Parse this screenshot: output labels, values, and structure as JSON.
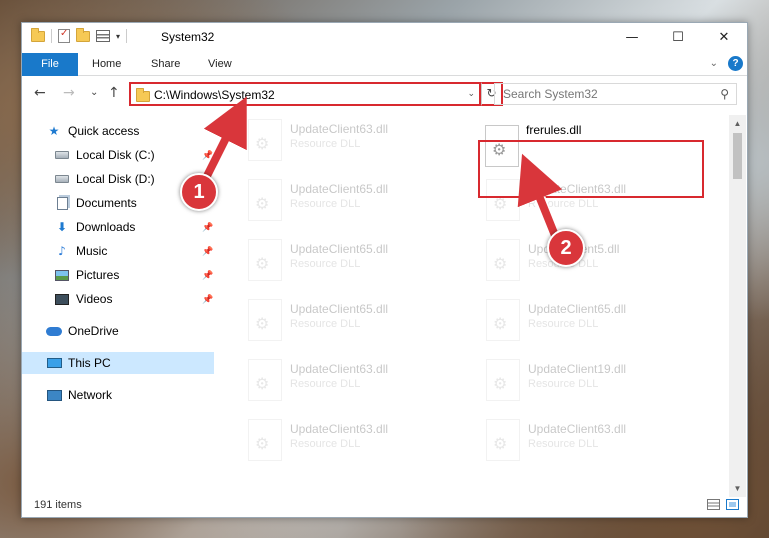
{
  "window": {
    "title": "System32",
    "controls": {
      "minimize": "—",
      "maximize": "☐",
      "close": "✕"
    }
  },
  "ribbon": {
    "tabs": [
      "File",
      "Home",
      "Share",
      "View"
    ],
    "help": "?"
  },
  "nav": {
    "back": "←",
    "forward": "→",
    "recent": "⌄",
    "up": "↑"
  },
  "address": {
    "path": "C:\\Windows\\System32",
    "dropdown": "⌄",
    "refresh": "↻"
  },
  "search": {
    "placeholder": "Search System32",
    "icon": "search-icon"
  },
  "sidebar": {
    "items": [
      {
        "label": "Quick access",
        "icon": "star-icon"
      },
      {
        "label": "Local Disk (C:)",
        "icon": "drive-icon",
        "pinned": true
      },
      {
        "label": "Local Disk (D:)",
        "icon": "drive-icon",
        "pinned": true
      },
      {
        "label": "Documents",
        "icon": "documents-icon",
        "pinned": true
      },
      {
        "label": "Downloads",
        "icon": "download-icon",
        "pinned": true
      },
      {
        "label": "Music",
        "icon": "music-icon",
        "pinned": true
      },
      {
        "label": "Pictures",
        "icon": "pictures-icon",
        "pinned": true
      },
      {
        "label": "Videos",
        "icon": "videos-icon",
        "pinned": true
      },
      {
        "label": "OneDrive",
        "icon": "cloud-icon"
      },
      {
        "label": "This PC",
        "icon": "computer-icon",
        "selected": true
      },
      {
        "label": "Network",
        "icon": "network-icon"
      }
    ]
  },
  "files": [
    {
      "name": "UpdateClient63.dll",
      "type": "Resource DLL"
    },
    {
      "name": "frerules.dll",
      "type": ""
    },
    {
      "name": "UpdateClient65.dll",
      "type": "Resource DLL"
    },
    {
      "name": "UpdateClient63.dll",
      "type": "Resource DLL"
    },
    {
      "name": "UpdateClient65.dll",
      "type": "Resource DLL"
    },
    {
      "name": "UpdateClient5.dll",
      "type": "Resource DLL"
    },
    {
      "name": "UpdateClient65.dll",
      "type": "Resource DLL"
    },
    {
      "name": "UpdateClient65.dll",
      "type": "Resource DLL"
    },
    {
      "name": "UpdateClient63.dll",
      "type": "Resource DLL"
    },
    {
      "name": "UpdateClient19.dll",
      "type": "Resource DLL"
    },
    {
      "name": "UpdateClient63.dll",
      "type": "Resource DLL"
    },
    {
      "name": "UpdateClient63.dll",
      "type": "Resource DLL"
    }
  ],
  "status": {
    "item_count": "191 items"
  },
  "annotations": {
    "step1": "1",
    "step2": "2",
    "color": "#d9363b"
  }
}
